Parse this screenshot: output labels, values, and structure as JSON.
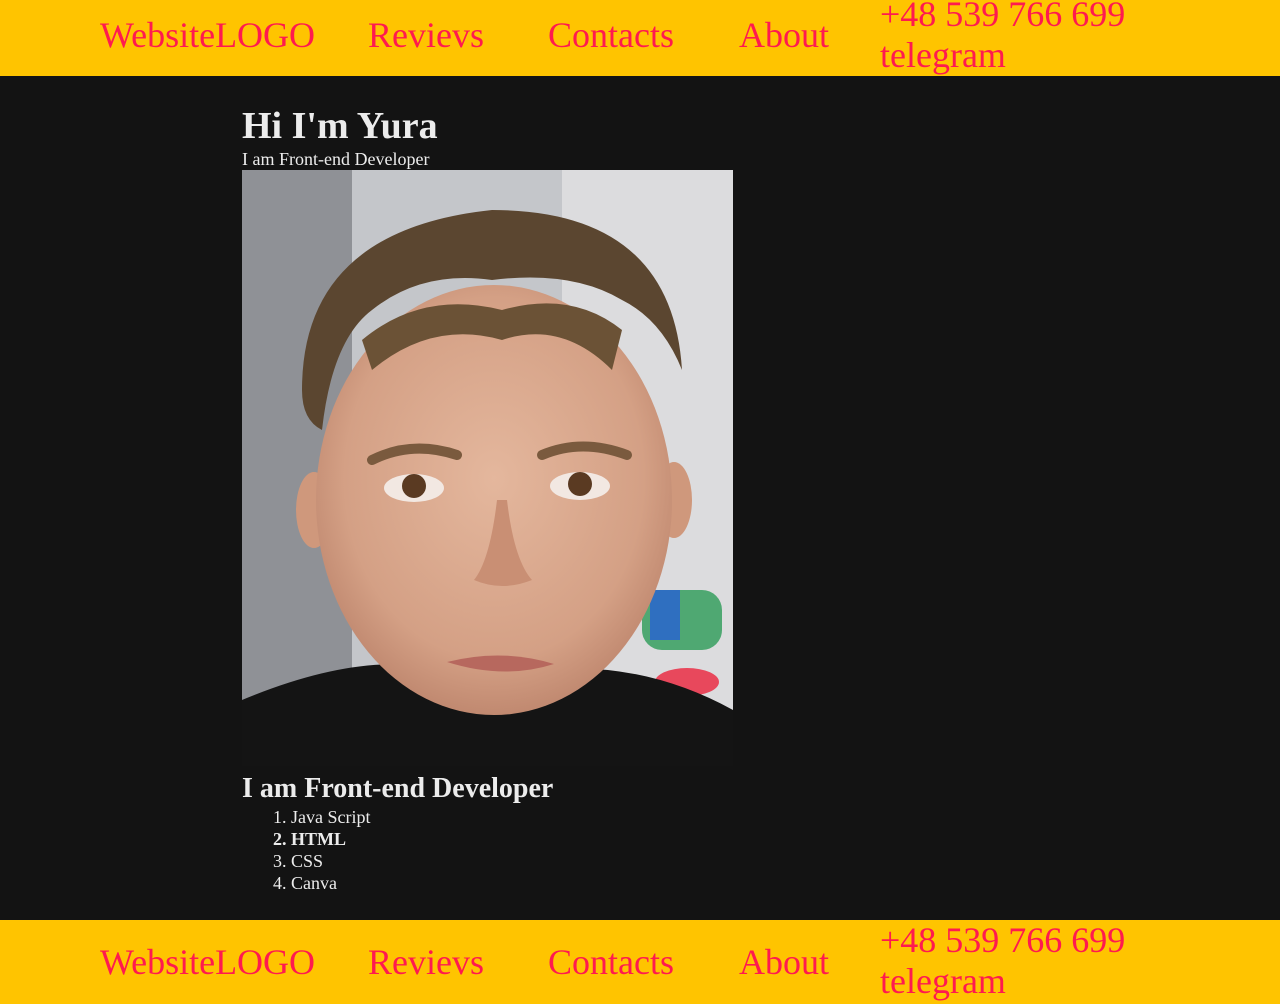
{
  "nav": {
    "logo": "WebsiteLOGO",
    "links": [
      "Revievs",
      "Contacts",
      "About"
    ],
    "phone": "+48 539 766 699",
    "telegram": "telegram"
  },
  "hero": {
    "title": "Hi I'm Yura",
    "subtitle": "I am Front-end Developer",
    "photo_alt": "portrait photo"
  },
  "skills": {
    "heading": "I am Front-end Developer",
    "items": [
      "Java Script",
      "HTML",
      "CSS",
      "Canva"
    ]
  },
  "colors": {
    "bar_bg": "#ffc400",
    "link": "#ff1a4f",
    "page_bg": "#131313",
    "text": "#ececec"
  }
}
